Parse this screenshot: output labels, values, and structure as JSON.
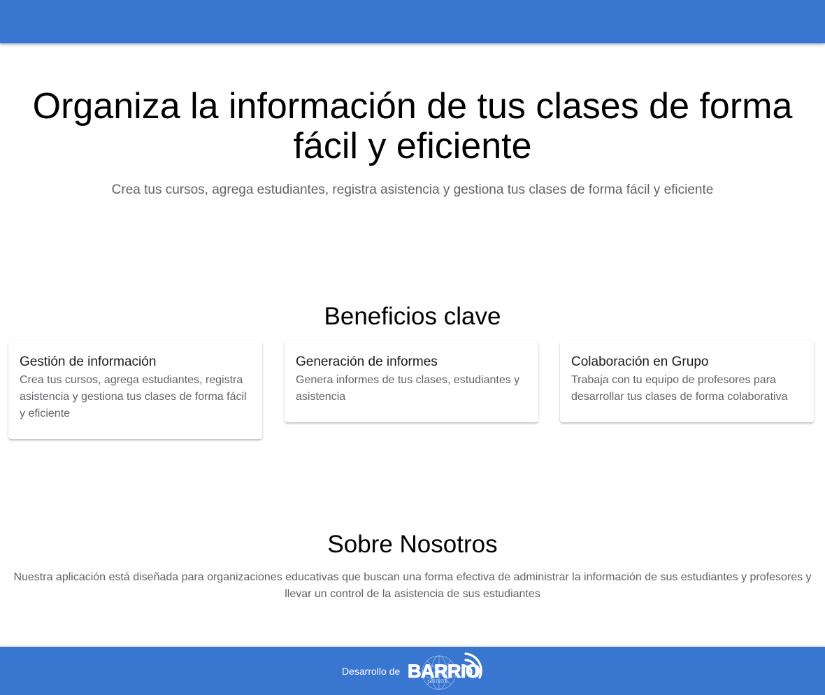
{
  "header": {
    "color": "#3876cf"
  },
  "hero": {
    "title": "Organiza la información de tus clases de forma fácil y eficiente",
    "subtitle": "Crea tus cursos, agrega estudiantes, registra asistencia y gestiona tus clases de forma fácil y eficiente"
  },
  "benefits": {
    "title": "Beneficios clave",
    "cards": [
      {
        "title": "Gestión de información",
        "text": "Crea tus cursos, agrega estudiantes, registra asistencia y gestiona tus clases de forma fácil y eficiente"
      },
      {
        "title": "Generación de informes",
        "text": "Genera informes de tus clases, estudiantes y asistencia"
      },
      {
        "title": "Colaboración en Grupo",
        "text": "Trabaja con tu equipo de profesores para desarrollar tus clases de forma colaborativa"
      }
    ]
  },
  "about": {
    "title": "Sobre Nosotros",
    "text": "Nuestra aplicación está diseñada para organizaciones educativas que buscan una forma efectiva de administrar la información de sus estudiantes y profesores y llevar un control de la asistencia de sus estudiantes"
  },
  "footer": {
    "label": "Desarrollo de",
    "logo_icon": "barrio-logo-icon",
    "color": "#3876cf"
  }
}
